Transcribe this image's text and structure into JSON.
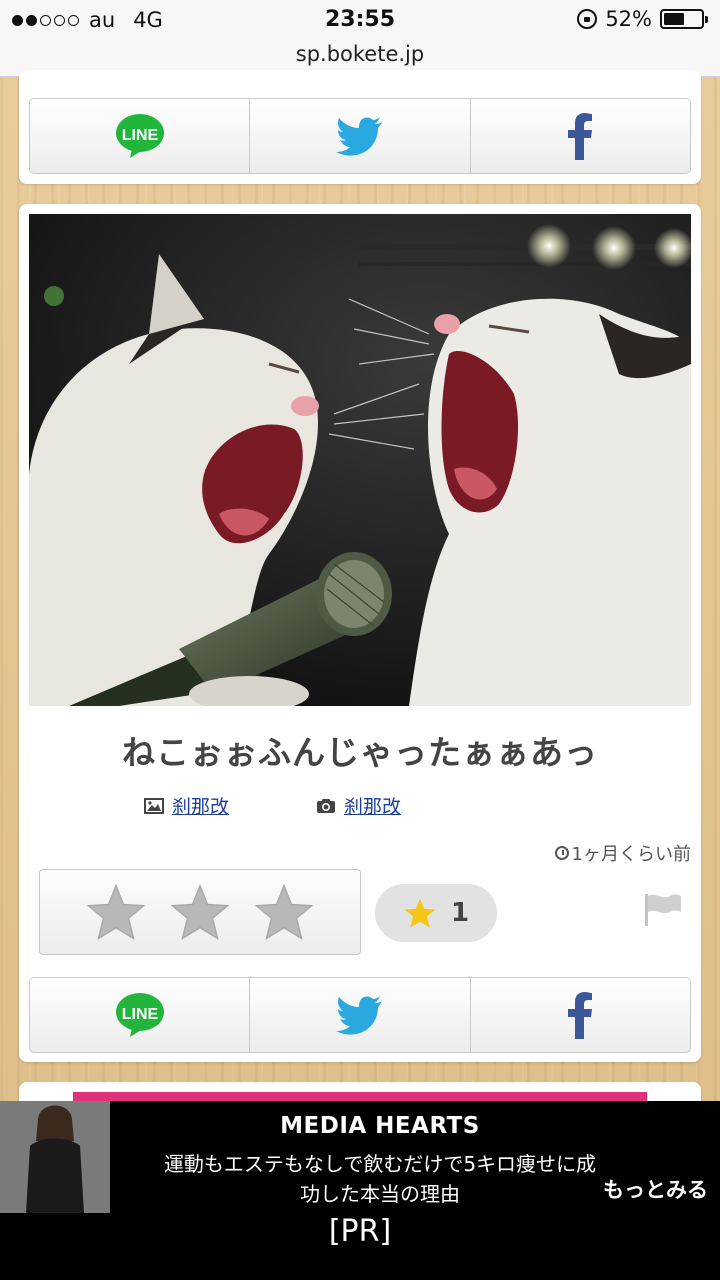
{
  "status": {
    "carrier": "au",
    "network": "4G",
    "time": "23:55",
    "battery": "52%",
    "url": "sp.bokete.jp"
  },
  "share": {
    "line_label": "LINE"
  },
  "post": {
    "caption": "ねこぉぉふんじゃったぁぁあっ",
    "image_author": "刹那改",
    "caption_author": "刹那改",
    "posted_ago": "1ヶ月くらい前",
    "favorites": "1"
  },
  "ad": {
    "brand": "MEDIA HEARTS",
    "text_line1": "運動もエステもなしで飲むだけで5キロ痩せに成",
    "text_line2": "功した本当の理由",
    "more": "もっとみる",
    "pr": "[PR]"
  }
}
